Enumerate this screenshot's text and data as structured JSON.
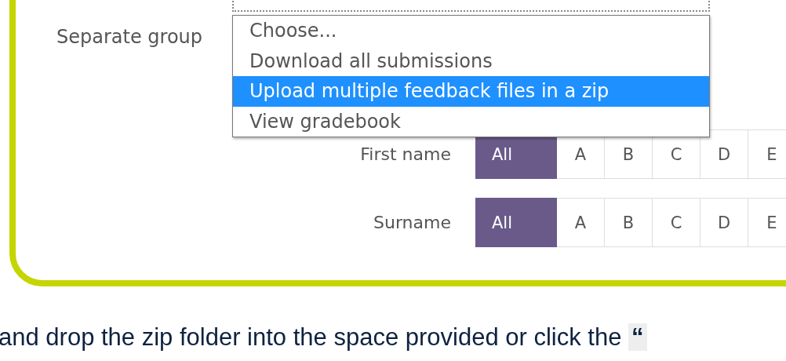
{
  "group_label": "Separate group",
  "dropdown": {
    "options": [
      {
        "label": "Choose...",
        "selected": false
      },
      {
        "label": "Download all submissions",
        "selected": false
      },
      {
        "label": "Upload multiple feedback files in a zip",
        "selected": true
      },
      {
        "label": "View gradebook",
        "selected": false
      }
    ]
  },
  "filters": [
    {
      "label": "First name",
      "letters": [
        {
          "label": "All",
          "selected": true
        },
        {
          "label": "A",
          "selected": false
        },
        {
          "label": "B",
          "selected": false
        },
        {
          "label": "C",
          "selected": false
        },
        {
          "label": "D",
          "selected": false
        },
        {
          "label": "E",
          "selected": false
        }
      ]
    },
    {
      "label": "Surname",
      "letters": [
        {
          "label": "All",
          "selected": true
        },
        {
          "label": "A",
          "selected": false
        },
        {
          "label": "B",
          "selected": false
        },
        {
          "label": "C",
          "selected": false
        },
        {
          "label": "D",
          "selected": false
        },
        {
          "label": "E",
          "selected": false
        }
      ]
    }
  ],
  "instruction": "and drop the zip folder into the space provided or click the **“**"
}
